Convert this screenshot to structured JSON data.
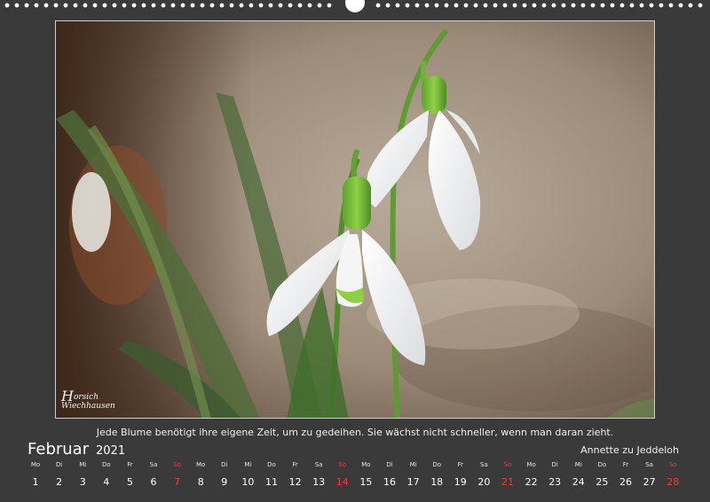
{
  "photo": {
    "subject": "Snowdrop flowers",
    "signature_lines": [
      "H",
      "orsich",
      "Wiechhausen"
    ]
  },
  "caption": "Jede Blume benötigt ihre eigene Zeit, um zu gedeihen. Sie wächst nicht schneller, wenn man daran zieht.",
  "calendar": {
    "month": "Februar",
    "year": "2021",
    "author": "Annette zu Jeddeloh",
    "days": [
      {
        "wd": "Mo",
        "n": "1"
      },
      {
        "wd": "Di",
        "n": "2"
      },
      {
        "wd": "Mi",
        "n": "3"
      },
      {
        "wd": "Do",
        "n": "4"
      },
      {
        "wd": "Fr",
        "n": "5"
      },
      {
        "wd": "Sa",
        "n": "6"
      },
      {
        "wd": "So",
        "n": "7",
        "sunday": true
      },
      {
        "wd": "Mo",
        "n": "8"
      },
      {
        "wd": "Di",
        "n": "9"
      },
      {
        "wd": "Mi",
        "n": "10"
      },
      {
        "wd": "Do",
        "n": "11"
      },
      {
        "wd": "Fr",
        "n": "12"
      },
      {
        "wd": "Sa",
        "n": "13"
      },
      {
        "wd": "So",
        "n": "14",
        "sunday": true
      },
      {
        "wd": "Mo",
        "n": "15"
      },
      {
        "wd": "Di",
        "n": "16"
      },
      {
        "wd": "Mi",
        "n": "17"
      },
      {
        "wd": "Do",
        "n": "18"
      },
      {
        "wd": "Fr",
        "n": "19"
      },
      {
        "wd": "Sa",
        "n": "20"
      },
      {
        "wd": "So",
        "n": "21",
        "sunday": true
      },
      {
        "wd": "Mo",
        "n": "22"
      },
      {
        "wd": "Di",
        "n": "23"
      },
      {
        "wd": "Mi",
        "n": "24"
      },
      {
        "wd": "Do",
        "n": "25"
      },
      {
        "wd": "Fr",
        "n": "26"
      },
      {
        "wd": "Sa",
        "n": "27"
      },
      {
        "wd": "So",
        "n": "28",
        "sunday": true
      }
    ]
  },
  "colors": {
    "background": "#3a3a3a",
    "sunday": "#e2433b",
    "text": "#ffffff"
  }
}
